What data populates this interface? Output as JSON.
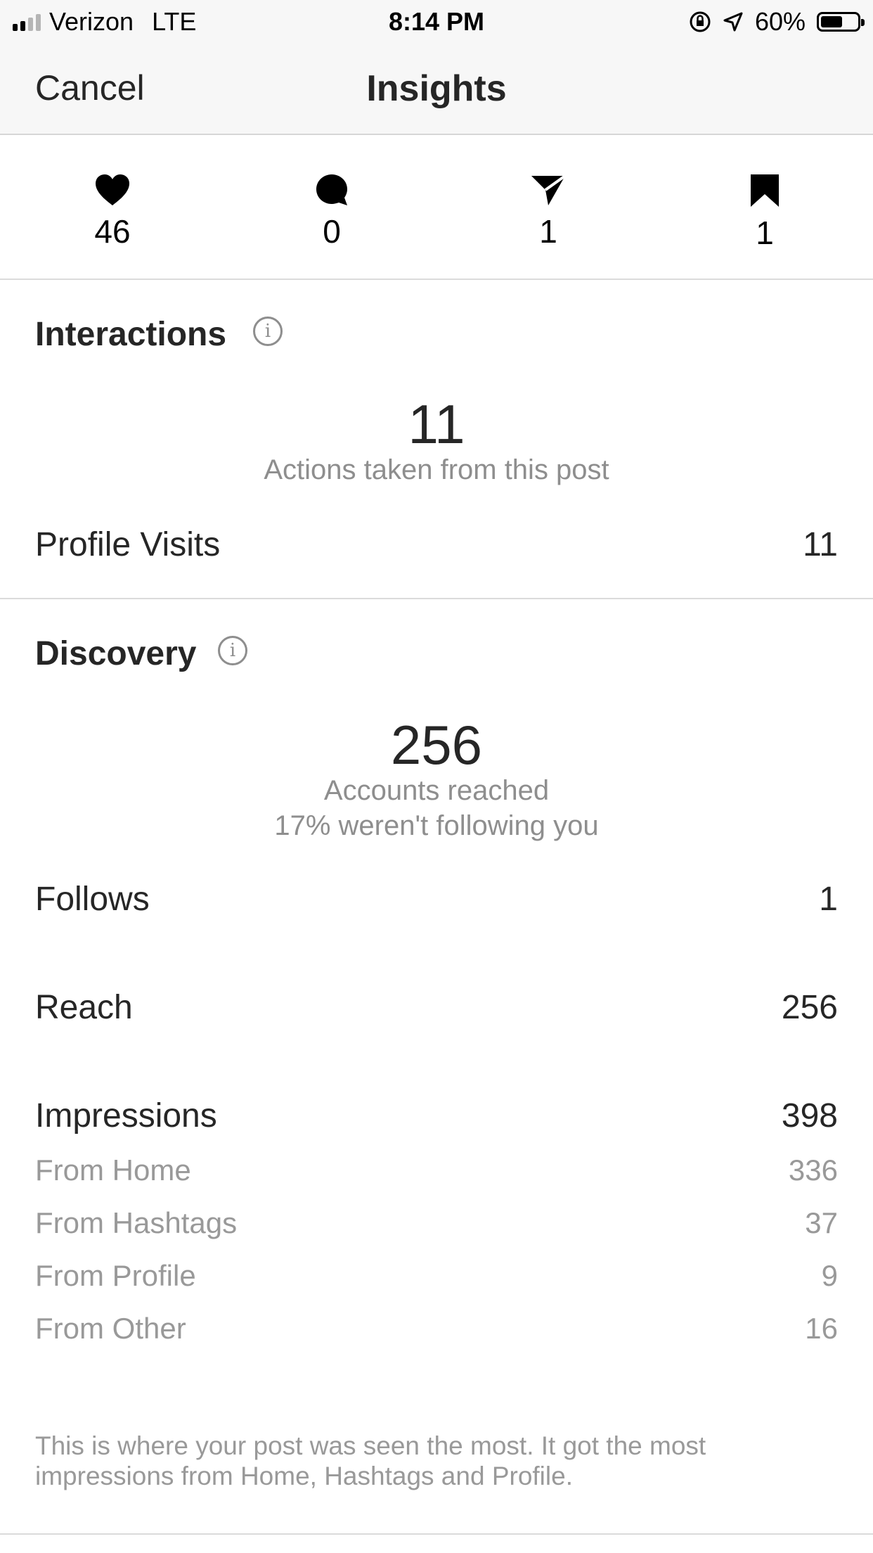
{
  "status_bar": {
    "carrier": "Verizon",
    "network": "LTE",
    "time": "8:14 PM",
    "battery_percent": "60%",
    "battery_level": 0.6
  },
  "nav": {
    "cancel_label": "Cancel",
    "title": "Insights"
  },
  "stats": [
    {
      "icon": "heart-icon",
      "value": "46"
    },
    {
      "icon": "comment-icon",
      "value": "0"
    },
    {
      "icon": "share-icon",
      "value": "1"
    },
    {
      "icon": "bookmark-icon",
      "value": "1"
    }
  ],
  "interactions": {
    "title": "Interactions",
    "big_number": "11",
    "caption": "Actions taken from this post",
    "rows": [
      {
        "label": "Profile Visits",
        "value": "11"
      }
    ]
  },
  "discovery": {
    "title": "Discovery",
    "big_number": "256",
    "caption": "Accounts reached",
    "subcaption": "17% weren't following you",
    "follows": {
      "label": "Follows",
      "value": "1"
    },
    "reach": {
      "label": "Reach",
      "value": "256"
    },
    "impressions": {
      "label": "Impressions",
      "value": "398"
    },
    "breakdown": [
      {
        "label": "From Home",
        "value": "336"
      },
      {
        "label": "From Hashtags",
        "value": "37"
      },
      {
        "label": "From Profile",
        "value": "9"
      },
      {
        "label": "From Other",
        "value": "16"
      }
    ],
    "note": "This is where your post was seen the most. It got the most impressions from Home, Hashtags and Profile."
  }
}
